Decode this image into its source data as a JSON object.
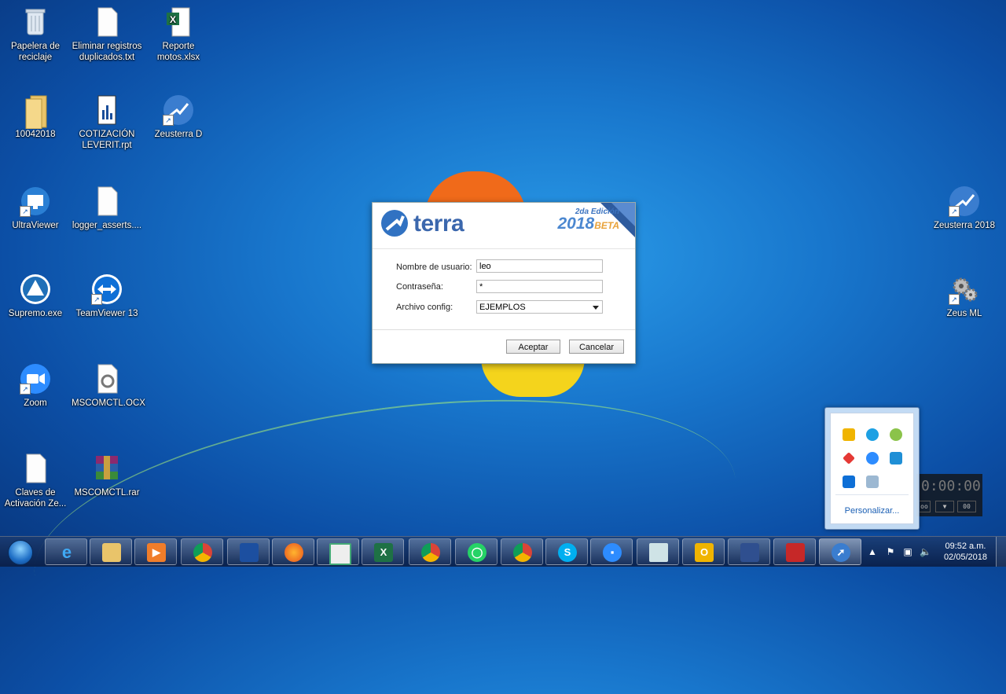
{
  "desktop": {
    "icons": [
      {
        "label": "Papelera de reciclaje",
        "icon": "recycle-bin-icon"
      },
      {
        "label": "Eliminar registros duplicados.txt",
        "icon": "text-file-icon"
      },
      {
        "label": "Reporte motos.xlsx",
        "icon": "excel-file-icon"
      },
      {
        "label": "10042018",
        "icon": "folder-icon"
      },
      {
        "label": "COTIZACIÓN LEVERIT.rpt",
        "icon": "report-file-icon"
      },
      {
        "label": "Zeusterra D",
        "icon": "zeusterra-icon"
      },
      {
        "label": "UltraViewer",
        "icon": "ultraviewer-icon"
      },
      {
        "label": "logger_asserts....",
        "icon": "text-file-icon"
      },
      {
        "label": "Supremo.exe",
        "icon": "supremo-icon"
      },
      {
        "label": "TeamViewer 13",
        "icon": "teamviewer-icon"
      },
      {
        "label": "Zoom",
        "icon": "zoom-icon"
      },
      {
        "label": "MSCOMCTL.OCX",
        "icon": "ocx-file-icon"
      },
      {
        "label": "Claves de Activación Ze...",
        "icon": "text-file-icon"
      },
      {
        "label": "MSCOMCTL.rar",
        "icon": "winrar-icon"
      },
      {
        "label": "Zeusterra 2018",
        "icon": "zeusterra-icon"
      },
      {
        "label": "Zeus ML",
        "icon": "gears-icon"
      }
    ]
  },
  "dialog": {
    "logo_text": "terra",
    "edition_label": "2da Edición",
    "edition_year": "2018",
    "edition_tag": "BETA",
    "username_label": "Nombre de usuario:",
    "username_value": "leo",
    "password_label": "Contraseña:",
    "password_value": "*",
    "config_label": "Archivo config:",
    "config_value": "EJEMPLOS",
    "accept_label": "Aceptar",
    "cancel_label": "Cancelar"
  },
  "tray_popup": {
    "customize_link": "Personalizar..."
  },
  "timer": {
    "display": "0:00:00",
    "btn_left": "00",
    "btn_right": "00"
  },
  "taskbar": {
    "clock_time": "09:52 a.m.",
    "clock_date": "02/05/2018",
    "apps": [
      "internet-explorer-icon",
      "file-explorer-icon",
      "media-player-icon",
      "chrome-icon",
      "remote-desktop-icon",
      "firefox-icon",
      "window-icon",
      "excel-icon",
      "chrome-icon",
      "whatsapp-icon",
      "chrome-icon",
      "skype-icon",
      "zoom-icon",
      "notepad-icon",
      "outlook-icon",
      "virtualbox-icon",
      "toolbox-icon",
      "zeusterra-icon"
    ]
  },
  "colors": {
    "dialog_brand": "#3b67ad",
    "beta": "#e8a23a",
    "link": "#1a5fb4"
  }
}
